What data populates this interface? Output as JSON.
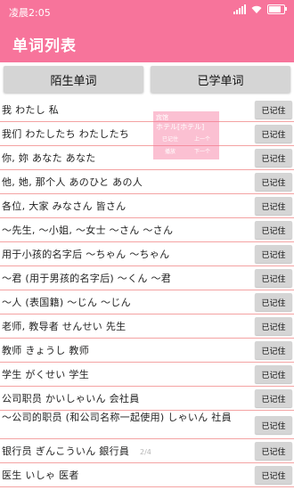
{
  "status": {
    "time": "凌晨2:05"
  },
  "header": {
    "title": "单词列表"
  },
  "tabs": [
    {
      "label": "陌生单词"
    },
    {
      "label": "已学单词"
    }
  ],
  "rows": [
    {
      "text": "我  わたし  私",
      "button": "已记住"
    },
    {
      "text": "我们  わたしたち  わたしたち",
      "button": "已记住"
    },
    {
      "text": "你, 妳  あなた  あなた",
      "button": "已记住"
    },
    {
      "text": "他, 她, 那个人  あのひと  あの人",
      "button": "已记住"
    },
    {
      "text": "各位, 大家  みなさん  皆さん",
      "button": "已记住"
    },
    {
      "text": "～先生, ～小姐, ～女士  ～さん  ～さん",
      "button": "已记住"
    },
    {
      "text": "用于小孩的名字后  ～ちゃん  ～ちゃん",
      "button": "已记住"
    },
    {
      "text": "～君 (用于男孩的名字后)  ～くん  ～君",
      "button": "已记住"
    },
    {
      "text": "～人 (表国籍)  ～じん  ～じん",
      "button": "已记住"
    },
    {
      "text": "老师, 教导者  せんせい  先生",
      "button": "已记住"
    },
    {
      "text": "教师  きょうし  教师",
      "button": "已记住"
    },
    {
      "text": "学生  がくせい  学生",
      "button": "已记住"
    },
    {
      "text": "公司职员  かいしゃいん  会社員",
      "button": "已记住"
    },
    {
      "text": "～公司的职员 (和公司名称一起使用)  しゃいん  社員",
      "button": "已记住"
    },
    {
      "text": "银行员  ぎんこういん  銀行員",
      "button": "已记住"
    },
    {
      "text": "医生  いしゃ  医者",
      "button": "已记住"
    }
  ],
  "popup": {
    "title": "宾馆",
    "word": "ホテル[ホテル]",
    "actions": {
      "remember": "已记住",
      "prev": "上一个",
      "play": "播放",
      "next": "下一个"
    }
  },
  "pager": {
    "text": "2/4"
  }
}
